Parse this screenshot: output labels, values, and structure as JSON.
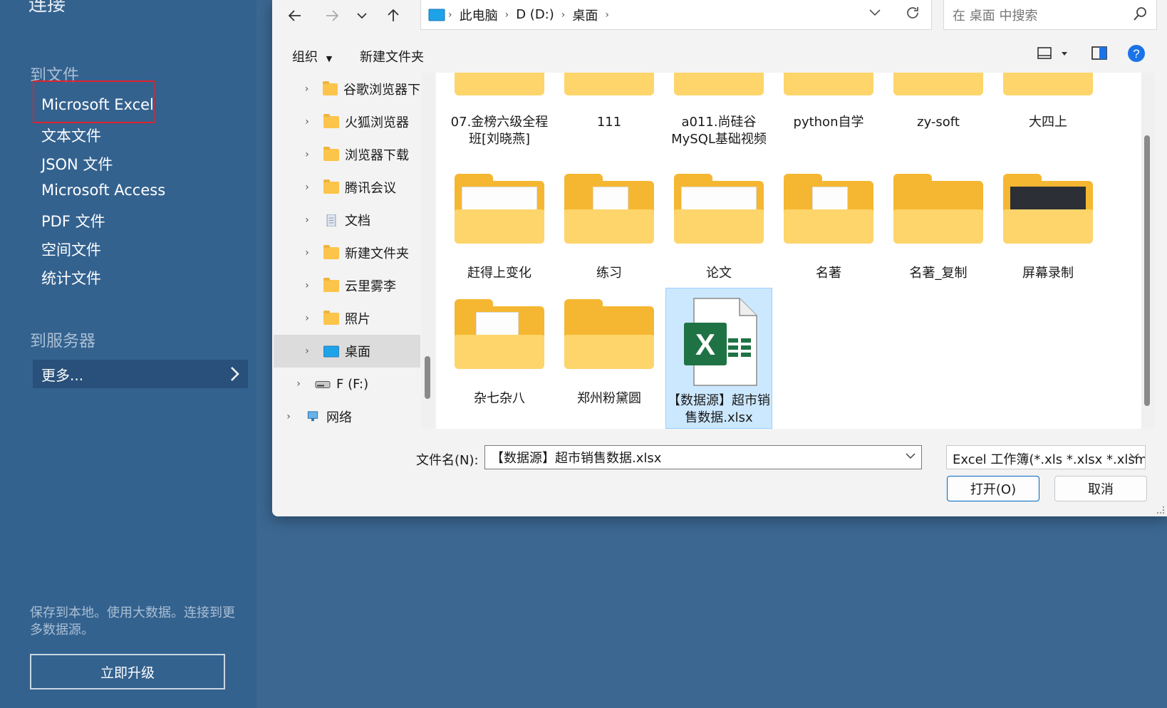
{
  "left_pane": {
    "title": "连接",
    "section_file": "到文件",
    "file_items": [
      "Microsoft Excel",
      "文本文件",
      "JSON 文件",
      "Microsoft Access",
      "PDF 文件",
      "空间文件",
      "统计文件"
    ],
    "section_server": "到服务器",
    "more_label": "更多...",
    "note": "保存到本地。使用大数据。连接到更多数据源。",
    "upgrade_label": "立即升级"
  },
  "dialog": {
    "breadcrumb": [
      "此电脑",
      "D (D:)",
      "桌面"
    ],
    "search_placeholder": "在 桌面 中搜索",
    "toolbar": {
      "organize": "组织",
      "new_folder": "新建文件夹"
    },
    "nav_items": [
      {
        "label": "谷歌浏览器下",
        "icon": "folder-icon"
      },
      {
        "label": "火狐浏览器",
        "icon": "folder-icon"
      },
      {
        "label": "浏览器下载",
        "icon": "folder-icon"
      },
      {
        "label": "腾讯会议",
        "icon": "folder-icon"
      },
      {
        "label": "文档",
        "icon": "document-icon"
      },
      {
        "label": "新建文件夹",
        "icon": "folder-icon"
      },
      {
        "label": "云里雾李",
        "icon": "folder-icon"
      },
      {
        "label": "照片",
        "icon": "folder-icon"
      },
      {
        "label": "桌面",
        "icon": "desktop-icon"
      },
      {
        "label": "F (F:)",
        "icon": "drive-icon"
      },
      {
        "label": "网络",
        "icon": "network-icon"
      }
    ],
    "files_row1": [
      "07.金榜六级全程班[刘晓燕]",
      "111",
      "a011.尚硅谷MySQL基础视频",
      "python自学",
      "zy-soft",
      "大四上"
    ],
    "files_row2": [
      "赶得上变化",
      "练习",
      "论文",
      "名著",
      "名著_复制",
      "屏幕录制"
    ],
    "files_row3": [
      "杂七杂八",
      "郑州粉黛圆",
      "【数据源】超市销售数据.xlsx"
    ],
    "filename_label": "文件名(N):",
    "filename_value": "【数据源】超市销售数据.xlsx",
    "filetype_value": "Excel 工作簿(*.xls *.xlsx *.xlsm)",
    "open_label": "打开(O)",
    "cancel_label": "取消"
  },
  "colors": {
    "left_bg": "#34628f",
    "highlight": "#e0232d",
    "folder": "#fdd56b",
    "excel_green": "#1f7244",
    "selection": "#cce8ff"
  }
}
